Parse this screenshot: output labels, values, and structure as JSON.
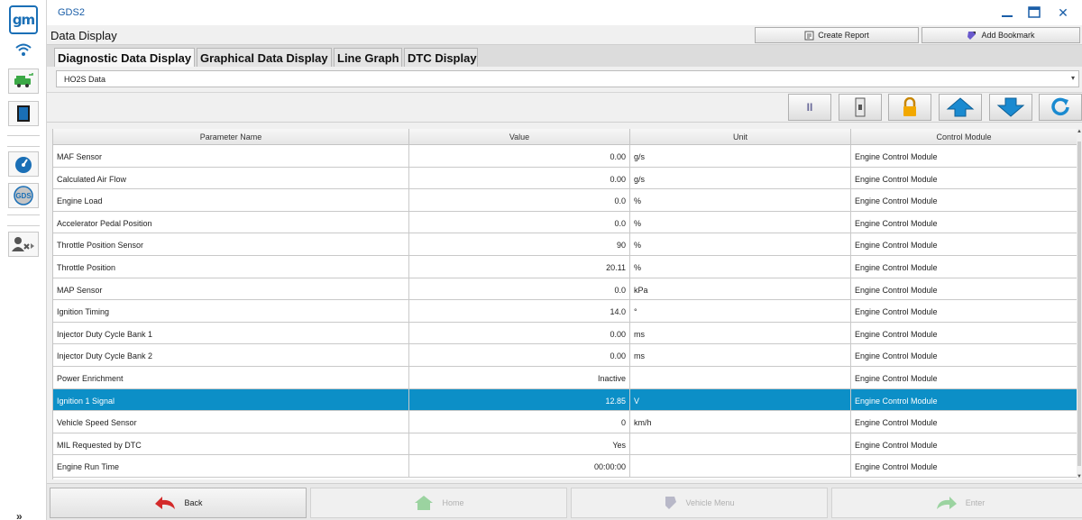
{
  "app": {
    "title": "GDS2",
    "logo_text": "gm",
    "close_glyph": "✕",
    "chevron_glyph": "»"
  },
  "rail": {
    "icons": [
      "gm-logo",
      "wifi-icon",
      "vehicle-icon",
      "device-icon",
      "gauge-icon",
      "gds-icon",
      "user-icon"
    ],
    "gds_label": "GDS"
  },
  "header": {
    "title": "Data Display",
    "create_report": "Create Report",
    "add_bookmark": "Add Bookmark"
  },
  "tabs": [
    {
      "label": "Diagnostic Data Display",
      "active": true
    },
    {
      "label": "Graphical Data Display",
      "active": false
    },
    {
      "label": "Line Graph",
      "active": false
    },
    {
      "label": "DTC Display",
      "active": false
    }
  ],
  "dropdown": {
    "selected": "HO2S Data",
    "arrow": "▾"
  },
  "toolbar": {
    "buttons": [
      "pause-icon",
      "switch-icon",
      "lock-icon",
      "scroll-up-icon",
      "scroll-down-icon",
      "refresh-icon"
    ],
    "pause_glyph": "II"
  },
  "table": {
    "columns": [
      "Parameter Name",
      "Value",
      "Unit",
      "Control Module"
    ],
    "rows": [
      {
        "name": "MAF Sensor",
        "value": "0.00",
        "unit": "g/s",
        "module": "Engine Control Module"
      },
      {
        "name": "Calculated Air Flow",
        "value": "0.00",
        "unit": "g/s",
        "module": "Engine Control Module"
      },
      {
        "name": "Engine Load",
        "value": "0.0",
        "unit": "%",
        "module": "Engine Control Module"
      },
      {
        "name": "Accelerator Pedal Position",
        "value": "0.0",
        "unit": "%",
        "module": "Engine Control Module"
      },
      {
        "name": "Throttle Position Sensor",
        "value": "90",
        "unit": "%",
        "module": "Engine Control Module"
      },
      {
        "name": "Throttle Position",
        "value": "20.11",
        "unit": "%",
        "module": "Engine Control Module"
      },
      {
        "name": "MAP Sensor",
        "value": "0.0",
        "unit": "kPa",
        "module": "Engine Control Module"
      },
      {
        "name": "Ignition Timing",
        "value": "14.0",
        "unit": "°",
        "module": "Engine Control Module"
      },
      {
        "name": "Injector Duty Cycle Bank 1",
        "value": "0.00",
        "unit": "ms",
        "module": "Engine Control Module"
      },
      {
        "name": "Injector Duty Cycle Bank 2",
        "value": "0.00",
        "unit": "ms",
        "module": "Engine Control Module"
      },
      {
        "name": "Power Enrichment",
        "value": "Inactive",
        "unit": "",
        "module": "Engine Control Module"
      },
      {
        "name": "Ignition 1 Signal",
        "value": "12.85",
        "unit": "V",
        "module": "Engine Control Module",
        "selected": true
      },
      {
        "name": "Vehicle Speed Sensor",
        "value": "0",
        "unit": "km/h",
        "module": "Engine Control Module"
      },
      {
        "name": "MIL Requested by DTC",
        "value": "Yes",
        "unit": "",
        "module": "Engine Control Module"
      },
      {
        "name": "Engine Run Time",
        "value": "00:00:00",
        "unit": "",
        "module": "Engine Control Module"
      }
    ]
  },
  "bottom_nav": [
    {
      "label": "Back",
      "enabled": true,
      "icon": "back-arrow-icon"
    },
    {
      "label": "Home",
      "enabled": false,
      "icon": "home-icon"
    },
    {
      "label": "Vehicle Menu",
      "enabled": false,
      "icon": "vehicle-menu-icon"
    },
    {
      "label": "Enter",
      "enabled": false,
      "icon": "enter-arrow-icon"
    }
  ],
  "colors": {
    "brand_blue": "#1a6fb6",
    "selected_row": "#0c8fc7",
    "green_icon": "#3aa845",
    "back_red": "#d32a2a",
    "lock_yellow": "#f2a800"
  }
}
